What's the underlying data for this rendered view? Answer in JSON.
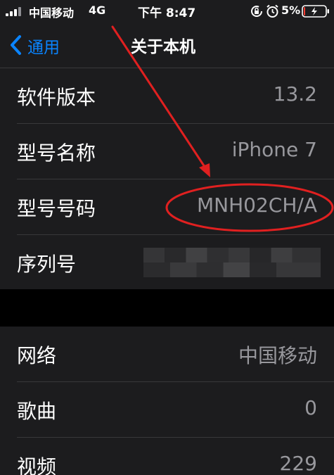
{
  "status_bar": {
    "carrier": "中国移动",
    "network": "4G",
    "time": "下午 8:47",
    "battery_percent": "5%",
    "icons": [
      "signal-icon",
      "lock-rotation-icon",
      "alarm-icon",
      "battery-icon"
    ],
    "battery_level": 0.05,
    "battery_color": "#ff3b30"
  },
  "nav": {
    "back_label": "通用",
    "back_icon": "chevron-left-icon",
    "title": "关于本机"
  },
  "about_rows": [
    {
      "label": "软件版本",
      "value": "13.2"
    },
    {
      "label": "型号名称",
      "value": "iPhone 7"
    },
    {
      "label": "型号号码",
      "value": "MNH02CH/A"
    },
    {
      "label": "序列号",
      "value": ""
    }
  ],
  "stats_rows": [
    {
      "label": "网络",
      "value": "中国移动"
    },
    {
      "label": "歌曲",
      "value": "0"
    },
    {
      "label": "视频",
      "value": "229"
    }
  ],
  "colors": {
    "accent": "#0a84ff",
    "annotation": "#e02020",
    "cell_background": "#1c1c1e",
    "secondary_text": "#98989d"
  }
}
